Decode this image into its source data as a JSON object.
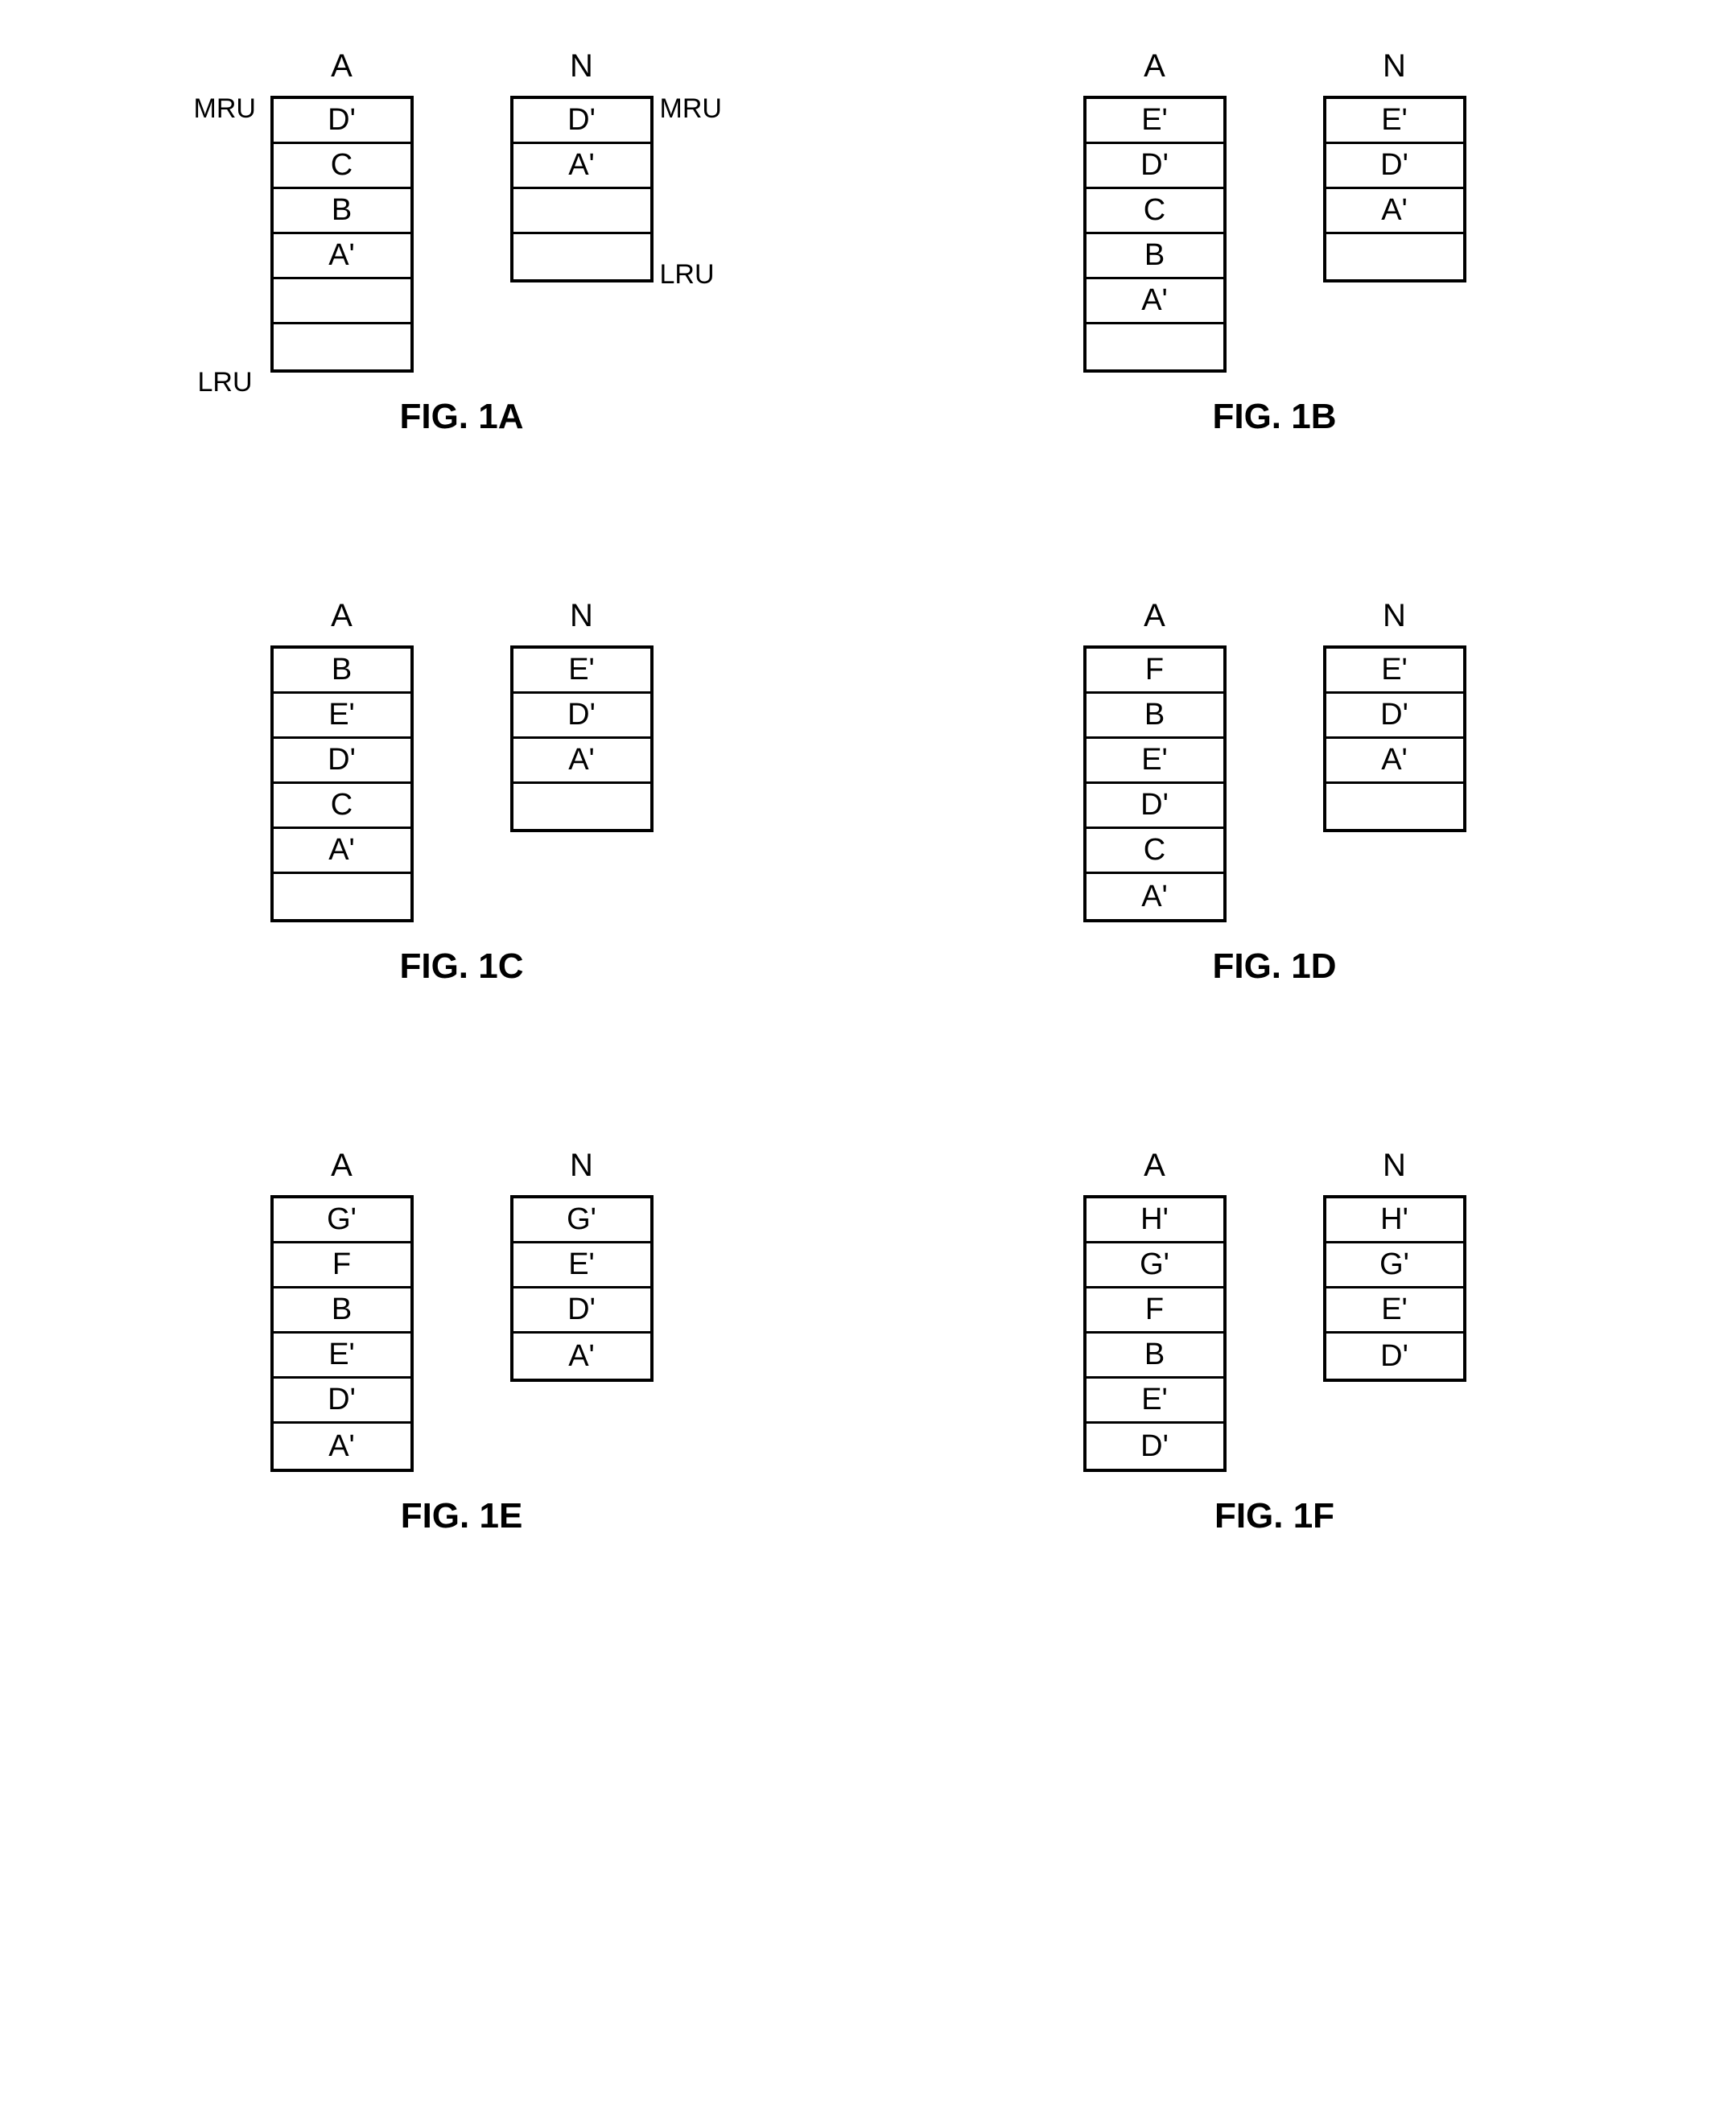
{
  "labels": {
    "mru": "MRU",
    "lru": "LRU"
  },
  "panels": [
    {
      "caption": "FIG. 1A",
      "showLabels": true,
      "stacks": [
        {
          "header": "A",
          "rows": 6,
          "cells": [
            "D'",
            "C",
            "B",
            "A'",
            "",
            ""
          ]
        },
        {
          "header": "N",
          "rows": 4,
          "cells": [
            "D'",
            "A'",
            "",
            ""
          ]
        }
      ]
    },
    {
      "caption": "FIG. 1B",
      "showLabels": false,
      "stacks": [
        {
          "header": "A",
          "rows": 6,
          "cells": [
            "E'",
            "D'",
            "C",
            "B",
            "A'",
            ""
          ]
        },
        {
          "header": "N",
          "rows": 4,
          "cells": [
            "E'",
            "D'",
            "A'",
            ""
          ]
        }
      ]
    },
    {
      "caption": "FIG. 1C",
      "showLabels": false,
      "stacks": [
        {
          "header": "A",
          "rows": 6,
          "cells": [
            "B",
            "E'",
            "D'",
            "C",
            "A'",
            ""
          ]
        },
        {
          "header": "N",
          "rows": 4,
          "cells": [
            "E'",
            "D'",
            "A'",
            ""
          ]
        }
      ]
    },
    {
      "caption": "FIG. 1D",
      "showLabels": false,
      "stacks": [
        {
          "header": "A",
          "rows": 6,
          "cells": [
            "F",
            "B",
            "E'",
            "D'",
            "C",
            "A'"
          ]
        },
        {
          "header": "N",
          "rows": 4,
          "cells": [
            "E'",
            "D'",
            "A'",
            ""
          ]
        }
      ]
    },
    {
      "caption": "FIG. 1E",
      "showLabels": false,
      "stacks": [
        {
          "header": "A",
          "rows": 6,
          "cells": [
            "G'",
            "F",
            "B",
            "E'",
            "D'",
            "A'"
          ]
        },
        {
          "header": "N",
          "rows": 4,
          "cells": [
            "G'",
            "E'",
            "D'",
            "A'"
          ]
        }
      ]
    },
    {
      "caption": "FIG. 1F",
      "showLabels": false,
      "stacks": [
        {
          "header": "A",
          "rows": 6,
          "cells": [
            "H'",
            "G'",
            "F",
            "B",
            "E'",
            "D'"
          ]
        },
        {
          "header": "N",
          "rows": 4,
          "cells": [
            "H'",
            "G'",
            "E'",
            "D'"
          ]
        }
      ]
    }
  ]
}
